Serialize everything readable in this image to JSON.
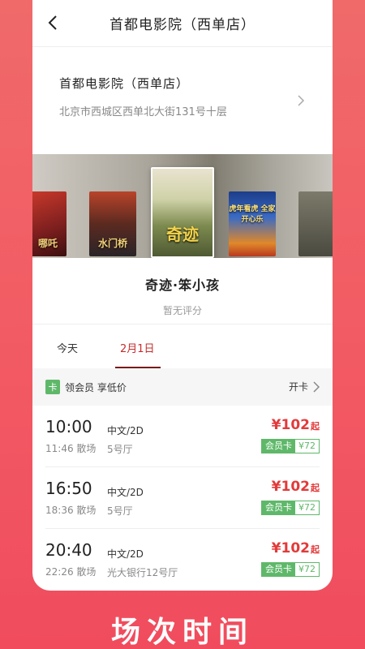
{
  "nav": {
    "title": "首都电影院（西单店）"
  },
  "cinema": {
    "name": "首都电影院（西单店）",
    "address": "北京市西城区西单北大街131号十层"
  },
  "posters": [
    {
      "text": "哪吒"
    },
    {
      "text": "水门桥"
    },
    {
      "text": "奇迹"
    },
    {
      "text": "虎年看虎 全家开心乐"
    },
    {
      "text": ""
    }
  ],
  "movie": {
    "title": "奇迹·笨小孩",
    "rating": "暂无评分"
  },
  "tabs": {
    "today": "今天",
    "date": "2月1日"
  },
  "member": {
    "badge": "卡",
    "text": "领会员 享低价",
    "open": "开卡"
  },
  "shows": [
    {
      "start": "10:00",
      "end": "11:46 散场",
      "lang": "中文/2D",
      "hall": "5号厅",
      "price": "¥102",
      "price_suffix": "起",
      "member_label": "会员卡",
      "member_price": "¥72"
    },
    {
      "start": "16:50",
      "end": "18:36 散场",
      "lang": "中文/2D",
      "hall": "5号厅",
      "price": "¥102",
      "price_suffix": "起",
      "member_label": "会员卡",
      "member_price": "¥72"
    },
    {
      "start": "20:40",
      "end": "22:26 散场",
      "lang": "中文/2D",
      "hall": "光大银行12号厅",
      "price": "¥102",
      "price_suffix": "起",
      "member_label": "会员卡",
      "member_price": "¥72"
    }
  ],
  "slogan": "场次时间",
  "colors": {
    "accent": "#e33a3a",
    "member_green": "#5fb86a",
    "background": "#f25a63"
  }
}
